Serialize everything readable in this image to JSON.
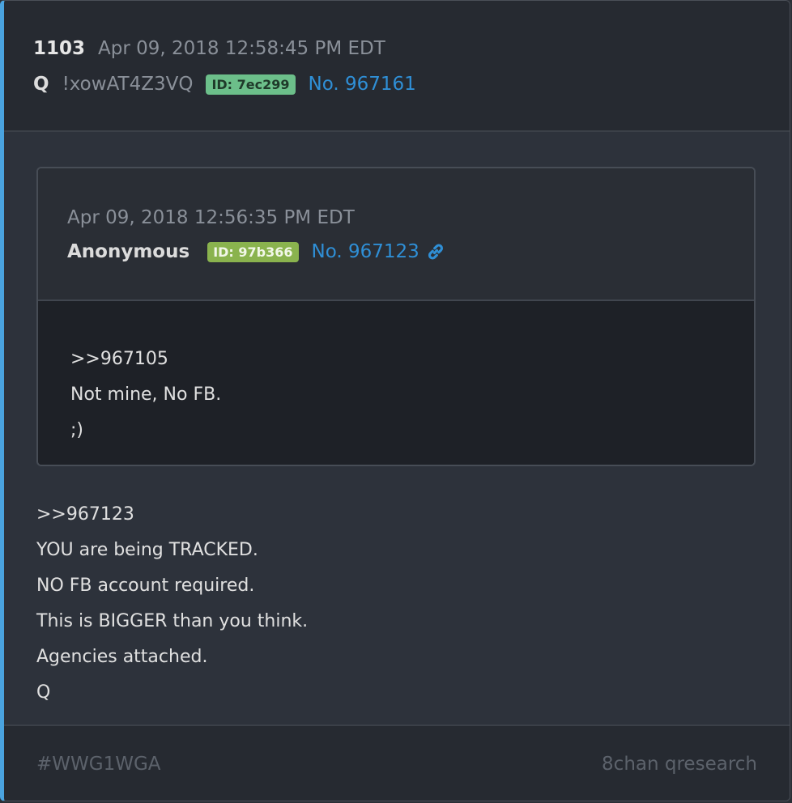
{
  "post": {
    "number": "1103",
    "timestamp": "Apr 09, 2018 12:58:45 PM EDT",
    "author": "Q",
    "tripcode": "!xowAT4Z3VQ",
    "id_badge": "ID: 7ec299",
    "post_link": "No. 967161",
    "body_lines": [
      ">>967123",
      "YOU are being TRACKED.",
      "NO FB account required.",
      "This is BIGGER than you think.",
      "Agencies attached.",
      "Q"
    ]
  },
  "quoted_post": {
    "timestamp": "Apr 09, 2018 12:56:35 PM EDT",
    "author": "Anonymous",
    "id_badge": "ID: 97b366",
    "post_link": "No. 967123",
    "link_icon": "link-icon",
    "body_lines": [
      ">>967105",
      "Not mine, No FB.",
      ";)"
    ]
  },
  "footer": {
    "hashtag": "#WWG1WGA",
    "source": "8chan qresearch"
  },
  "colors": {
    "accent_bar": "#4aa3df",
    "link": "#2f8fd6",
    "id_badge_q": "#6cbf8a",
    "id_badge_anon": "#8ab34e"
  }
}
